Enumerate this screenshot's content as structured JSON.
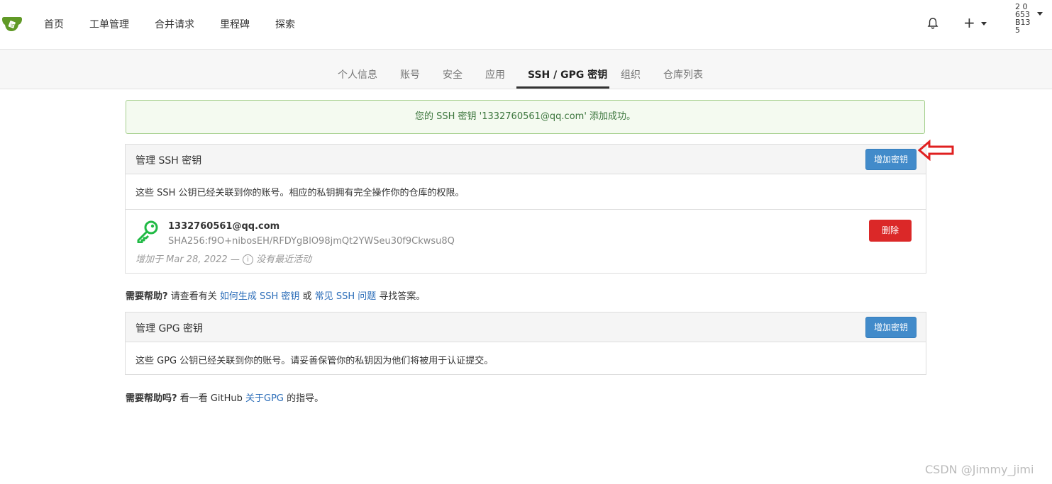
{
  "nav": {
    "items": [
      {
        "label": "首页"
      },
      {
        "label": "工单管理"
      },
      {
        "label": "合并请求"
      },
      {
        "label": "里程碑"
      },
      {
        "label": "探索"
      }
    ],
    "avatar_alt": "2 0 653 B13 5",
    "plus_label": "+"
  },
  "tabs": [
    {
      "label": "个人信息"
    },
    {
      "label": "账号"
    },
    {
      "label": "安全"
    },
    {
      "label": "应用"
    },
    {
      "label": "SSH / GPG 密钥",
      "active": true
    },
    {
      "label": "组织"
    },
    {
      "label": "仓库列表"
    }
  ],
  "flash": {
    "message": "您的 SSH 密钥 '1332760561@qq.com' 添加成功。"
  },
  "ssh": {
    "title": "管理 SSH 密钥",
    "add_button": "增加密钥",
    "description": "这些 SSH 公钥已经关联到你的账号。相应的私钥拥有完全操作你的仓库的权限。",
    "keys": [
      {
        "name": "1332760561@qq.com",
        "fingerprint": "SHA256:f9O+nibosEH/RFDYgBlO98jmQt2YWSeu30f9Ckwsu8Q",
        "added_prefix": "增加于 Mar 28, 2022 —",
        "activity": "没有最近活动",
        "delete_button": "删除"
      }
    ]
  },
  "ssh_help": {
    "prefix": "需要帮助?",
    "text1": "请查看有关",
    "link1": "如何生成 SSH 密钥",
    "text2": "或",
    "link2": "常见 SSH 问题",
    "text3": "寻找答案。"
  },
  "gpg": {
    "title": "管理 GPG 密钥",
    "add_button": "增加密钥",
    "description": "这些 GPG 公钥已经关联到你的账号。请妥善保管你的私钥因为他们将被用于认证提交。"
  },
  "gpg_help": {
    "prefix": "需要帮助吗?",
    "text1": "看一看 GitHub",
    "link1": "关于GPG",
    "text2": "的指导。"
  },
  "watermark": "CSDN @Jimmy_jimi",
  "colors": {
    "primary": "#428bca",
    "danger": "#db2828",
    "success_text": "#3c763d",
    "key_icon": "#21ba45",
    "annotation_arrow": "#e02020"
  }
}
